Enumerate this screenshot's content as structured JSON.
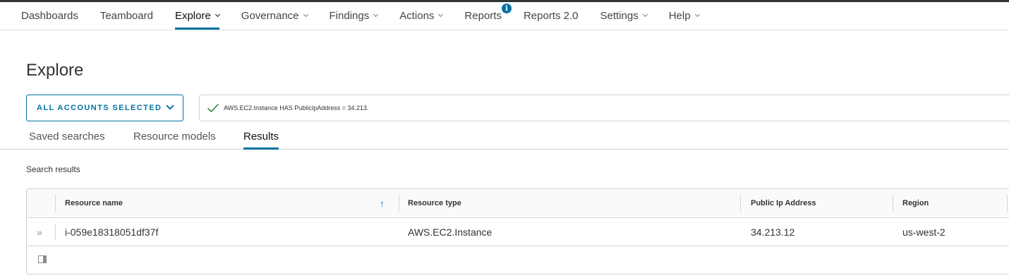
{
  "nav": {
    "items": [
      {
        "label": "Dashboards",
        "has_caret": false
      },
      {
        "label": "Teamboard",
        "has_caret": false
      },
      {
        "label": "Explore",
        "has_caret": true,
        "active": true
      },
      {
        "label": "Governance",
        "has_caret": true
      },
      {
        "label": "Findings",
        "has_caret": true
      },
      {
        "label": "Actions",
        "has_caret": true
      },
      {
        "label": "Reports",
        "has_caret": false,
        "badge": "info-icon"
      },
      {
        "label": "Reports 2.0",
        "has_caret": false
      },
      {
        "label": "Settings",
        "has_caret": true
      },
      {
        "label": "Help",
        "has_caret": true
      }
    ],
    "badge_text": "i"
  },
  "page": {
    "title": "Explore"
  },
  "filters": {
    "accounts_label": "ALL ACCOUNTS SELECTED",
    "query": "AWS.EC2.Instance HAS PublicIpAddress = 34.213.",
    "query_status_icon": "check-icon"
  },
  "tabs": [
    {
      "label": "Saved searches"
    },
    {
      "label": "Resource models"
    },
    {
      "label": "Results",
      "active": true
    }
  ],
  "results": {
    "label": "Search results",
    "columns": [
      "Resource name",
      "Resource type",
      "Public Ip Address",
      "Region"
    ],
    "sort_column": "Resource name",
    "sort_direction": "ascending",
    "rows": [
      {
        "resource_name": "i-059e18318051df37f",
        "resource_type": "AWS.EC2.Instance",
        "public_ip": "34.213.12",
        "region": "us-west-2"
      }
    ]
  },
  "colors": {
    "accent": "#0072a3",
    "top_strip": "#303538",
    "success": "#2e8540"
  }
}
